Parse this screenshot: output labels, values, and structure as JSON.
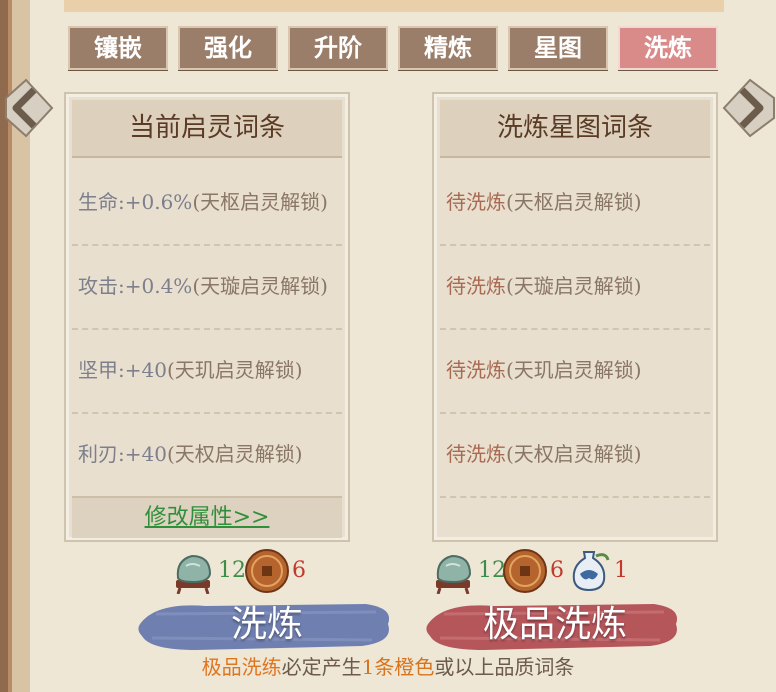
{
  "tabs": [
    {
      "label": "镶嵌"
    },
    {
      "label": "强化"
    },
    {
      "label": "升阶"
    },
    {
      "label": "精炼"
    },
    {
      "label": "星图"
    },
    {
      "label": "洗炼"
    }
  ],
  "active_tab": "洗炼",
  "left_panel": {
    "title": "当前启灵词条",
    "rows": [
      {
        "stat": "生命:+0.6%",
        "lock": "(天枢启灵解锁)"
      },
      {
        "stat": "攻击:+0.4%",
        "lock": "(天璇启灵解锁)"
      },
      {
        "stat": "坚甲:+40",
        "lock": "(天玑启灵解锁)"
      },
      {
        "stat": "利刃:+40",
        "lock": "(天权启灵解锁)"
      }
    ],
    "modify_label": "修改属性>>"
  },
  "right_panel": {
    "title": "洗炼星图词条",
    "rows": [
      {
        "stat": "待洗炼",
        "lock": "(天枢启灵解锁)"
      },
      {
        "stat": "待洗炼",
        "lock": "(天璇启灵解锁)"
      },
      {
        "stat": "待洗炼",
        "lock": "(天玑启灵解锁)"
      },
      {
        "stat": "待洗炼",
        "lock": "(天权启灵解锁)"
      }
    ]
  },
  "normal_cost": {
    "stone_count": "12",
    "coin_count": "6"
  },
  "premium_cost": {
    "stone_count": "12",
    "coin_count": "6",
    "vase_count": "1"
  },
  "buttons": {
    "normal": "洗炼",
    "premium": "极品洗炼"
  },
  "footnote": {
    "part1": "极品洗练",
    "part2": "必定产生",
    "part3": "1条橙色",
    "part4": "或以上品质词条"
  },
  "icons": {
    "left_arrow": "chevron-left-icon",
    "right_arrow": "chevron-right-icon",
    "stone": "jade-stone-icon",
    "coin": "bronze-coin-icon",
    "vase": "porcelain-vase-icon"
  },
  "colors": {
    "tab": "#9b7e69",
    "tab_active": "#d98b8a",
    "normal_button": "#6f7fb0",
    "premium_button": "#b5565b",
    "green_link": "#2f8f3a",
    "highlight": "#e07520"
  }
}
